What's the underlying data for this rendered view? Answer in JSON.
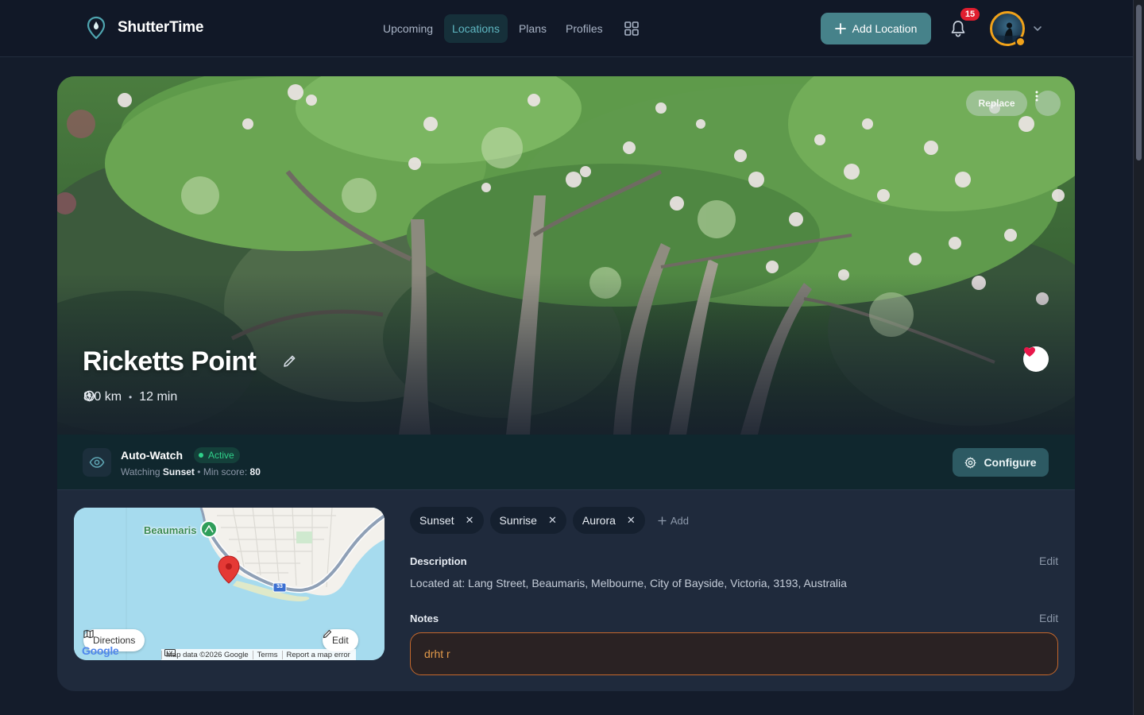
{
  "app": {
    "name": "ShutterTime"
  },
  "nav": {
    "items": [
      {
        "label": "Upcoming",
        "active": false
      },
      {
        "label": "Locations",
        "active": true
      },
      {
        "label": "Plans",
        "active": false
      },
      {
        "label": "Profiles",
        "active": false
      }
    ],
    "grid_icon": "grid-icon"
  },
  "header": {
    "add_location_label": "Add Location",
    "notifications_count": "15"
  },
  "location": {
    "title": "Ricketts Point",
    "distance": "8.0 km",
    "travel_time": "12 min",
    "favorite": true,
    "replace_label": "Replace"
  },
  "auto_watch": {
    "title": "Auto-Watch",
    "status": "Active",
    "watching_prefix": "Watching",
    "watching_event": "Sunset",
    "min_score_label": "Min score:",
    "min_score": "80",
    "configure_label": "Configure"
  },
  "map": {
    "place_label": "Beaumaris",
    "route_shield": "33",
    "directions_label": "Directions",
    "edit_label": "Edit",
    "google_logo": "Google",
    "attribution": [
      "Map data ©2026 Google",
      "Terms",
      "Report a map error"
    ]
  },
  "tags": {
    "items": [
      {
        "label": "Sunset"
      },
      {
        "label": "Sunrise"
      },
      {
        "label": "Aurora"
      }
    ],
    "add_label": "Add"
  },
  "description": {
    "title": "Description",
    "edit_label": "Edit",
    "text": "Located at: Lang Street, Beaumaris, Melbourne, City of Bayside, Victoria, 3193, Australia"
  },
  "notes": {
    "title": "Notes",
    "edit_label": "Edit",
    "value": "drht r"
  },
  "colors": {
    "background": "#141c2b",
    "accent": "#46828a",
    "active_status": "#2fd08a",
    "notes_border": "#c5682c",
    "badge": "#e01e2f"
  }
}
